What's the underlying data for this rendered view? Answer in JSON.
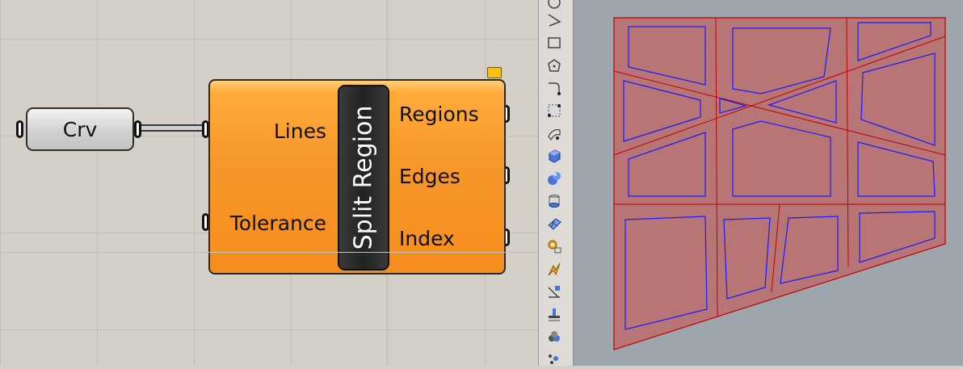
{
  "canvas": {
    "crv_node": {
      "label": "Crv"
    },
    "split_region": {
      "title": "Split Region",
      "inputs": [
        "Lines",
        "Tolerance"
      ],
      "outputs": [
        "Regions",
        "Edges",
        "Index"
      ]
    }
  },
  "toolbar": {
    "tools": [
      "circle-tool-icon",
      "polyline-tool-icon",
      "rectangle-tool-icon",
      "polygon-tool-icon",
      "curve-fillet-tool-icon",
      "control-point-curve-icon",
      "surface-from-curves-icon",
      "box-tool-icon",
      "sphere-tool-icon",
      "cylinder-tool-icon",
      "mesh-surface-icon",
      "cog-puzzle-icon",
      "analyze-lightning-icon",
      "dimension-tool-icon",
      "annotation-tool-icon",
      "render-color-icon",
      "points-tool-icon"
    ]
  },
  "colors": {
    "canvas_bg": "#d4d0c8",
    "component_orange": "#f7982a",
    "viewport_bg": "#9ea6ad",
    "region_fill": "#b87575",
    "boundary_red": "#c00000",
    "region_blue": "#1a1aff"
  }
}
